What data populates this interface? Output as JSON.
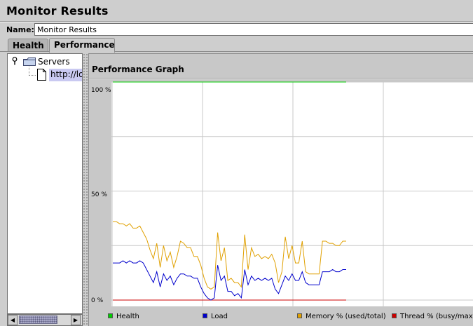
{
  "window": {
    "title": "Monitor Results"
  },
  "name_field": {
    "label": "Name:",
    "value": "Monitor Results"
  },
  "tabs": [
    {
      "label": "Health",
      "selected": false
    },
    {
      "label": "Performance",
      "selected": true
    }
  ],
  "tree": {
    "root": "Servers",
    "child": "http://localhost"
  },
  "graph": {
    "title": "Performance Graph",
    "y_ticks": [
      "100 %",
      "50 %",
      "0 %"
    ]
  },
  "legend": [
    {
      "label": "Health",
      "color": "#00cc00"
    },
    {
      "label": "Load",
      "color": "#0000cc"
    },
    {
      "label": "Memory % (used/total)",
      "color": "#e0a000"
    },
    {
      "label": "Thread % (busy/max)",
      "color": "#cc0000"
    }
  ],
  "chart_data": {
    "type": "line",
    "ylim": [
      0,
      100
    ],
    "grid": true,
    "legend_position": "bottom",
    "series": [
      {
        "name": "Health",
        "color": "#00cc00",
        "values": [
          100,
          100,
          100,
          100,
          100,
          100,
          100,
          100,
          100,
          100,
          100,
          100,
          100,
          100,
          100,
          100,
          100,
          100,
          100,
          100,
          100,
          100,
          100,
          100,
          100,
          100,
          100,
          100,
          100,
          100,
          100,
          100,
          100,
          100,
          100,
          100,
          100,
          100,
          100,
          100,
          100,
          100,
          100,
          100,
          100,
          100,
          100,
          100,
          100,
          100,
          100,
          100,
          100,
          100,
          100,
          100,
          100,
          100,
          100,
          100,
          100,
          100,
          100,
          100,
          100,
          100,
          100,
          100,
          100,
          100
        ]
      },
      {
        "name": "Load",
        "color": "#0000cc",
        "values": [
          17,
          17,
          17,
          18,
          17,
          18,
          17,
          17,
          18,
          17,
          14,
          11,
          8,
          13,
          6,
          12,
          9,
          11,
          7,
          10,
          12,
          12,
          11,
          11,
          10,
          10,
          6,
          3,
          1,
          0,
          1,
          16,
          9,
          11,
          4,
          4,
          2,
          3,
          1,
          14,
          7,
          11,
          9,
          10,
          9,
          10,
          9,
          10,
          5,
          3,
          7,
          11,
          9,
          12,
          9,
          9,
          13,
          8,
          7,
          7,
          7,
          7,
          13,
          13,
          13,
          14,
          13,
          13,
          14,
          14
        ]
      },
      {
        "name": "Memory % (used/total)",
        "color": "#e0a000",
        "values": [
          36,
          36,
          35,
          35,
          34,
          35,
          33,
          33,
          34,
          31,
          28,
          23,
          19,
          26,
          15,
          25,
          18,
          22,
          15,
          20,
          27,
          26,
          24,
          24,
          20,
          20,
          16,
          10,
          6,
          5,
          6,
          31,
          18,
          24,
          9,
          10,
          8,
          8,
          6,
          30,
          14,
          24,
          20,
          21,
          19,
          20,
          19,
          21,
          17,
          8,
          13,
          29,
          19,
          25,
          17,
          17,
          27,
          13,
          12,
          12,
          12,
          12,
          27,
          27,
          26,
          26,
          25,
          25,
          27,
          27
        ]
      },
      {
        "name": "Thread % (busy/max)",
        "color": "#cc0000",
        "values": [
          0,
          0,
          0,
          0,
          0,
          0,
          0,
          0,
          0,
          0,
          0,
          0,
          0,
          0,
          0,
          0,
          0,
          0,
          0,
          0,
          0,
          0,
          0,
          0,
          0,
          0,
          0,
          0,
          0,
          0,
          0,
          0,
          0,
          0,
          0,
          0,
          0,
          0,
          0,
          0,
          0,
          0,
          0,
          0,
          0,
          0,
          0,
          0,
          0,
          0,
          0,
          0,
          0,
          0,
          0,
          0,
          0,
          0,
          0,
          0,
          0,
          0,
          0,
          0,
          0,
          0,
          0,
          0,
          0,
          0
        ]
      }
    ]
  }
}
